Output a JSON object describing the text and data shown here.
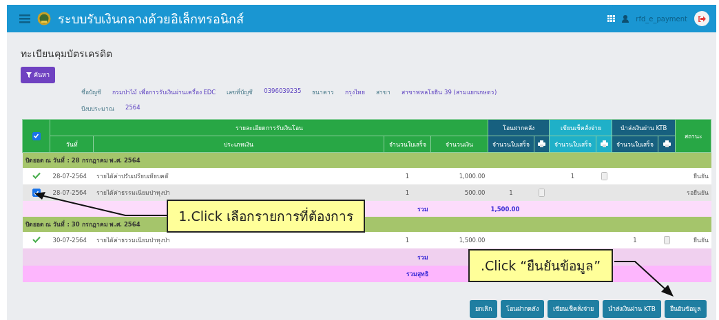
{
  "header": {
    "title": "ระบบรับเงินกลางด้วยอิเล็กทรอนิกส์",
    "username": "rfd_e_payment"
  },
  "page_title": "ทะเบียนคุมบัตรเครดิต",
  "search_button": "ค้นหา",
  "account_info": [
    [
      {
        "label": "ชื่อบัญชี",
        "value": "กรมป่าไม้ เพื่อการรับเงินผ่านเครื่อง EDC"
      },
      {
        "label": "เลขที่บัญชี",
        "value": "0396039235"
      },
      {
        "label": "ธนาคาร",
        "value": "กรุงไทย"
      },
      {
        "label": "สาขา",
        "value": "สาขาพหลโยธิน 39 (สามแยกเกษตร)"
      }
    ],
    [
      {
        "label": "ปีงบประมาณ",
        "value": "2564"
      }
    ]
  ],
  "table": {
    "select_all_checked": true,
    "group_headers": {
      "details": "รายละเอียดการรับเงินโอน",
      "transfer": "โอนฝากคลัง",
      "cheque": "เขียนเช็คสั่งจ่าย",
      "ktb": "นำส่งเงินผ่าน KTB",
      "status": "สถานะ"
    },
    "columns": {
      "date": "วันที่",
      "type": "ประเภทเงิน",
      "receipts": "จำนวนใบเสร็จ",
      "amount": "จำนวนเงิน",
      "transfer_receipts": "จำนวนใบเสร็จ",
      "cheque_receipts": "จำนวนใบเสร็จ",
      "ktb_receipts": "จำนวนใบเสร็จ"
    },
    "groups": [
      {
        "title": "ปิดยอด ณ วันที่ : 28 กรกฎาคม พ.ศ. 2564",
        "rows": [
          {
            "kind": "confirmed",
            "date": "28-07-2564",
            "type": "รายได้ค่าปรับเปรียบเทียบคดี",
            "receipts": "1",
            "amount": "1,000.00",
            "cheque": {
              "receipts": "1",
              "document": true
            },
            "status": "ยืนยัน"
          },
          {
            "kind": "checkbox",
            "checked": true,
            "date": "28-07-2564",
            "type": "รายได้ค่าธรรมเนียมป่าทุงป่า",
            "receipts": "1",
            "amount": "500.00",
            "transfer": {
              "receipts": "1",
              "document": true
            },
            "status": "รอยืนยัน"
          }
        ],
        "sum": {
          "label": "รวม",
          "value": "1,500.00"
        }
      },
      {
        "title": "ปิดยอด ณ วันที่ : 30 กรกฎาคม พ.ศ. 2564",
        "rows": [
          {
            "kind": "confirmed",
            "date": "30-07-2564",
            "type": "รายได้ค่าธรรมเนียมป่าทุงป่า",
            "receipts": "1",
            "amount": "1,500.00",
            "ktb": {
              "receipts": "1",
              "document": true
            },
            "status": "ยืนยัน"
          }
        ],
        "sum": {
          "label": "รวม"
        }
      }
    ],
    "net_sum": {
      "label": "รวมสุทธิ"
    }
  },
  "buttons": [
    "ยกเลิก",
    "โอนฝากคลัง",
    "เขียนเช็คสั่งจ่าย",
    "นำส่งเงินผ่าน KTB",
    "ยืนยันข้อมูล"
  ],
  "callouts": [
    {
      "text": "1.Click เลือกรายการที่ต้องการ"
    },
    {
      "text": ".Click “ยืนยันข้อมูล”"
    }
  ]
}
